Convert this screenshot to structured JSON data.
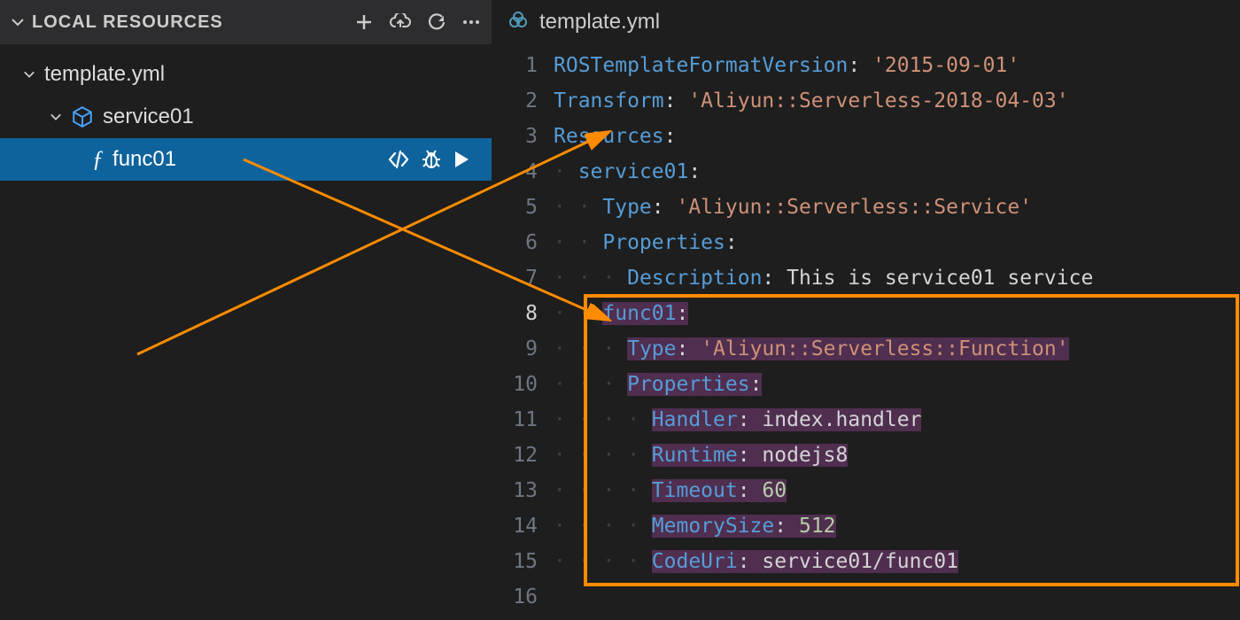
{
  "sidebar": {
    "title": "LOCAL RESOURCES",
    "tree": {
      "root_label": "template.yml",
      "service_label": "service01",
      "func_label": "func01"
    }
  },
  "tab": {
    "filename": "template.yml"
  },
  "code": {
    "lines": [
      {
        "num": "1",
        "key": "ROSTemplateFormatVersion",
        "sep": ": ",
        "val": "'2015-09-01'",
        "vtype": "str",
        "indent": 0,
        "hl": false
      },
      {
        "num": "2",
        "key": "Transform",
        "sep": ": ",
        "val": "'Aliyun::Serverless-2018-04-03'",
        "vtype": "str",
        "indent": 0,
        "hl": false
      },
      {
        "num": "3",
        "key": "Resources",
        "sep": ":",
        "val": "",
        "vtype": "",
        "indent": 0,
        "hl": false
      },
      {
        "num": "4",
        "key": "service01",
        "sep": ":",
        "val": "",
        "vtype": "",
        "indent": 1,
        "hl": false
      },
      {
        "num": "5",
        "key": "Type",
        "sep": ": ",
        "val": "'Aliyun::Serverless::Service'",
        "vtype": "str",
        "indent": 2,
        "hl": false
      },
      {
        "num": "6",
        "key": "Properties",
        "sep": ":",
        "val": "",
        "vtype": "",
        "indent": 2,
        "hl": false
      },
      {
        "num": "7",
        "key": "Description",
        "sep": ": ",
        "val": "This is service01 service",
        "vtype": "plain",
        "indent": 3,
        "hl": false
      },
      {
        "num": "8",
        "key": "func01",
        "sep": ":",
        "val": "",
        "vtype": "",
        "indent": 2,
        "hl": true,
        "active": true
      },
      {
        "num": "9",
        "key": "Type",
        "sep": ": ",
        "val": "'Aliyun::Serverless::Function'",
        "vtype": "str",
        "indent": 3,
        "hl": true
      },
      {
        "num": "10",
        "key": "Properties",
        "sep": ":",
        "val": "",
        "vtype": "",
        "indent": 3,
        "hl": true
      },
      {
        "num": "11",
        "key": "Handler",
        "sep": ": ",
        "val": "index.handler",
        "vtype": "plain",
        "indent": 4,
        "hl": true
      },
      {
        "num": "12",
        "key": "Runtime",
        "sep": ": ",
        "val": "nodejs8",
        "vtype": "plain",
        "indent": 4,
        "hl": true
      },
      {
        "num": "13",
        "key": "Timeout",
        "sep": ": ",
        "val": "60",
        "vtype": "num",
        "indent": 4,
        "hl": true
      },
      {
        "num": "14",
        "key": "MemorySize",
        "sep": ": ",
        "val": "512",
        "vtype": "num",
        "indent": 4,
        "hl": true
      },
      {
        "num": "15",
        "key": "CodeUri",
        "sep": ": ",
        "val": "service01/func01",
        "vtype": "plain",
        "indent": 4,
        "hl": true
      },
      {
        "num": "16",
        "key": "",
        "sep": "",
        "val": "",
        "vtype": "",
        "indent": 0,
        "hl": false
      }
    ]
  }
}
